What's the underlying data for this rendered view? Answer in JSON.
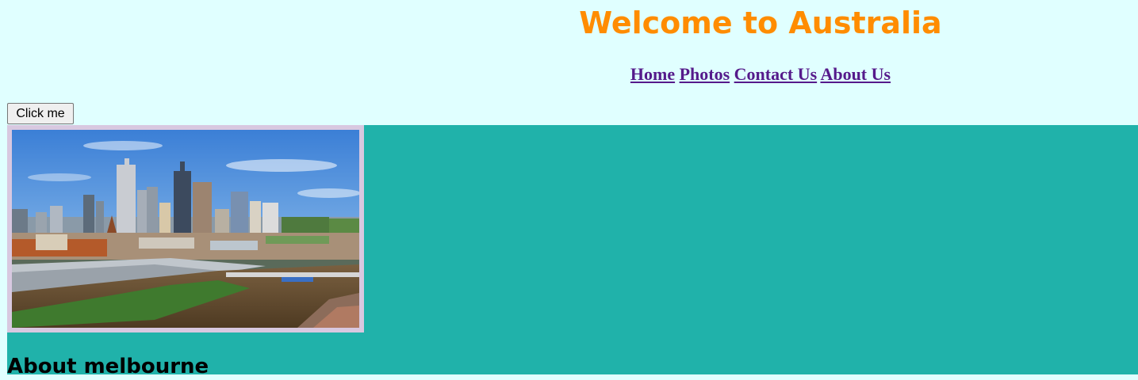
{
  "header": {
    "title": "Welcome to Australia",
    "title_color": "#ff8c00",
    "nav": [
      {
        "label": "Home"
      },
      {
        "label": "Photos"
      },
      {
        "label": "Contact Us"
      },
      {
        "label": "About Us"
      }
    ]
  },
  "button": {
    "label": "Click me"
  },
  "main": {
    "background": "#20b2aa",
    "image_subject": "Melbourne city skyline with Yarra River",
    "section_heading": "About melbourne"
  }
}
